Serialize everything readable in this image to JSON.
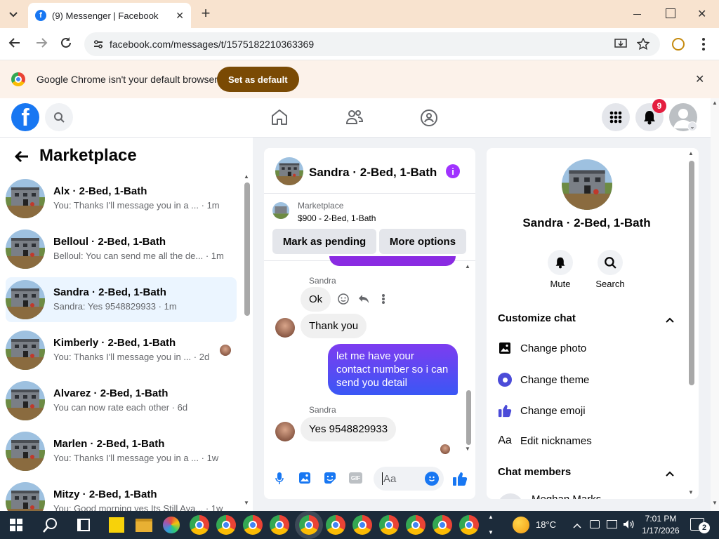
{
  "browser": {
    "tab_title": "(9) Messenger | Facebook",
    "url": "facebook.com/messages/t/1575182210363369",
    "infobar_text": "Google Chrome isn't your default browser",
    "set_default_label": "Set as default"
  },
  "nav": {
    "notifications_count": "9"
  },
  "sidebar": {
    "title": "Marketplace",
    "conversations": [
      {
        "name": "Alx · 2-Bed, 1-Bath",
        "preview": "You: Thanks I'll message you in a ...",
        "time": "· 1m"
      },
      {
        "name": "Belloul · 2-Bed, 1-Bath",
        "preview": "Belloul: You can send me all the de...",
        "time": "· 1m"
      },
      {
        "name": "Sandra · 2-Bed, 1-Bath",
        "preview": "Sandra: Yes 9548829933",
        "time": "· 1m"
      },
      {
        "name": "Kimberly · 2-Bed, 1-Bath",
        "preview": "You: Thanks I'll message you in ...",
        "time": "· 2d"
      },
      {
        "name": "Alvarez · 2-Bed, 1-Bath",
        "preview": "You can now rate each other",
        "time": "· 6d"
      },
      {
        "name": "Marlen · 2-Bed, 1-Bath",
        "preview": "You: Thanks I'll message you in a ...",
        "time": "· 1w"
      },
      {
        "name": "Mitzy · 2-Bed, 1-Bath",
        "preview": "You: Good morning yes Its Still Ava...",
        "time": "· 1w"
      }
    ]
  },
  "chat": {
    "header_name": "Sandra · 2-Bed, 1-Bath",
    "listing_source": "Marketplace",
    "listing_detail": "$900 - 2-Bed, 1-Bath",
    "mark_pending_label": "Mark as pending",
    "more_options_label": "More options",
    "messages": [
      {
        "sender": "Sandra",
        "text": "Ok"
      },
      {
        "text": "Thank you"
      },
      {
        "text": "let me have your contact number so i can send you detail"
      },
      {
        "sender": "Sandra",
        "text": "Yes 9548829933"
      }
    ],
    "composer_placeholder": "Aa"
  },
  "details": {
    "name": "Sandra · 2-Bed, 1-Bath",
    "mute_label": "Mute",
    "search_label": "Search",
    "customize_label": "Customize chat",
    "options": [
      {
        "label": "Change photo",
        "icon": "photo-icon"
      },
      {
        "label": "Change theme",
        "icon": "theme-icon"
      },
      {
        "label": "Change emoji",
        "icon": "thumbs-up-icon"
      },
      {
        "label": "Edit nicknames",
        "icon": "nickname-icon"
      }
    ],
    "members_label": "Chat members",
    "member_name": "Meghan Marks"
  },
  "taskbar": {
    "temperature": "18°C",
    "time": "7:01 PM",
    "date": "1/17/2026",
    "notification_count": "2"
  },
  "colors": {
    "facebook_blue": "#1877f2",
    "messenger_purple": "#a033ff",
    "notification_red": "#e41e3f"
  }
}
